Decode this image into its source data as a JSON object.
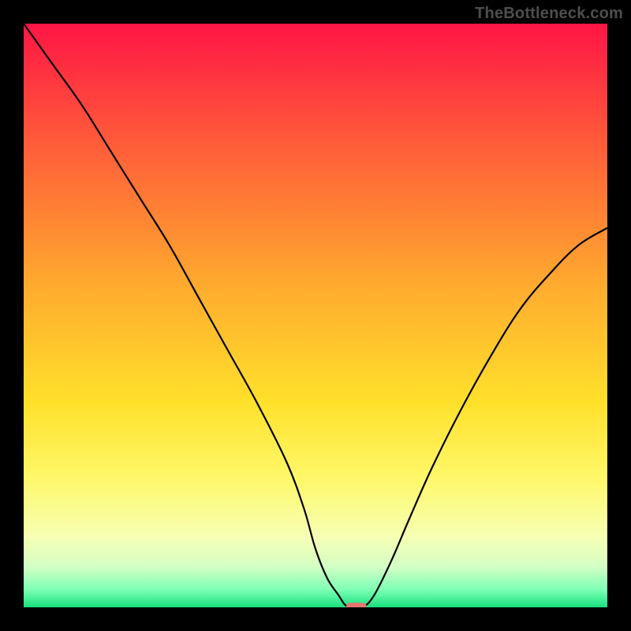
{
  "watermark": "TheBottleneck.com",
  "chart_data": {
    "type": "line",
    "title": "",
    "xlabel": "",
    "ylabel": "",
    "xlim": [
      0,
      100
    ],
    "ylim": [
      0,
      100
    ],
    "grid": false,
    "legend": false,
    "background": {
      "gradient_stops": [
        {
          "pos": 0.0,
          "color": "#ff1545"
        },
        {
          "pos": 0.2,
          "color": "#ff5a3a"
        },
        {
          "pos": 0.45,
          "color": "#ffab2e"
        },
        {
          "pos": 0.65,
          "color": "#ffe12b"
        },
        {
          "pos": 0.78,
          "color": "#fff86a"
        },
        {
          "pos": 0.88,
          "color": "#f6ffb5"
        },
        {
          "pos": 0.93,
          "color": "#d4ffc4"
        },
        {
          "pos": 0.97,
          "color": "#7dffb4"
        },
        {
          "pos": 1.0,
          "color": "#17e07e"
        }
      ]
    },
    "series": [
      {
        "name": "bottleneck-curve",
        "color": "#000000",
        "stroke_width": 2.2,
        "points": [
          {
            "x": 0,
            "y": 100
          },
          {
            "x": 5,
            "y": 93
          },
          {
            "x": 10,
            "y": 86
          },
          {
            "x": 15,
            "y": 78
          },
          {
            "x": 20,
            "y": 70
          },
          {
            "x": 25,
            "y": 62
          },
          {
            "x": 30,
            "y": 53
          },
          {
            "x": 35,
            "y": 44
          },
          {
            "x": 40,
            "y": 35
          },
          {
            "x": 45,
            "y": 25
          },
          {
            "x": 48,
            "y": 17
          },
          {
            "x": 50,
            "y": 10
          },
          {
            "x": 52,
            "y": 5
          },
          {
            "x": 54,
            "y": 2
          },
          {
            "x": 55,
            "y": 0.5
          },
          {
            "x": 56,
            "y": 0
          },
          {
            "x": 58,
            "y": 0
          },
          {
            "x": 60,
            "y": 2
          },
          {
            "x": 63,
            "y": 8
          },
          {
            "x": 66,
            "y": 15
          },
          {
            "x": 70,
            "y": 24
          },
          {
            "x": 75,
            "y": 34
          },
          {
            "x": 80,
            "y": 43
          },
          {
            "x": 85,
            "y": 51
          },
          {
            "x": 90,
            "y": 57
          },
          {
            "x": 95,
            "y": 62
          },
          {
            "x": 100,
            "y": 65
          }
        ]
      }
    ],
    "marker": {
      "name": "optimal-point",
      "x": 57,
      "y": 0,
      "width_pct": 3.5,
      "height_pct": 1.6,
      "color": "#e4776e"
    }
  },
  "colors": {
    "frame": "#000000",
    "watermark": "#4e4e4e"
  }
}
